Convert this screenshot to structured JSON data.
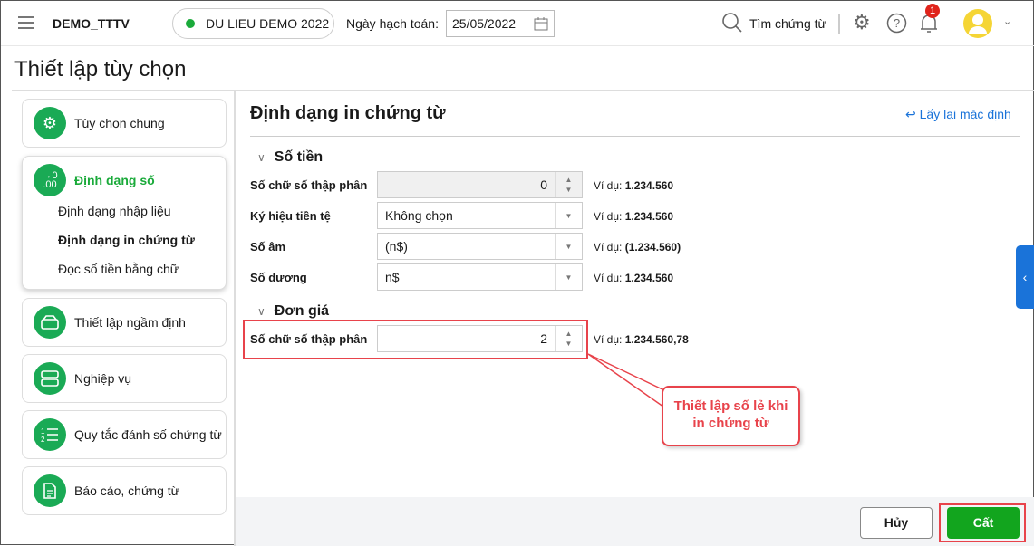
{
  "header": {
    "app_name": "DEMO_TTTV",
    "database": "DU LIEU DEMO 2022",
    "date_label": "Ngày hạch toán:",
    "date_value": "25/05/2022",
    "search_label": "Tìm chứng từ",
    "notification_count": "1"
  },
  "page_title": "Thiết lập tùy chọn",
  "sidebar": {
    "items": [
      {
        "label": "Tùy chọn chung",
        "icon": "gear-icon"
      },
      {
        "label": "Định dạng số",
        "icon": "decimal-icon",
        "active": true,
        "subitems": [
          {
            "label": "Định dạng nhập liệu"
          },
          {
            "label": "Định dạng in chứng từ",
            "active": true
          },
          {
            "label": "Đọc số tiền bằng chữ"
          }
        ]
      },
      {
        "label": "Thiết lập ngầm định",
        "icon": "drive-icon"
      },
      {
        "label": "Nghiệp vụ",
        "icon": "server-icon"
      },
      {
        "label": "Quy tắc đánh số chứng từ",
        "icon": "numbered-list-icon"
      },
      {
        "label": "Báo cáo, chứng từ",
        "icon": "document-icon"
      }
    ]
  },
  "main": {
    "title": "Định dạng in chứng từ",
    "reset_label": "Lấy lại mặc định",
    "sections": [
      {
        "title": "Số tiền",
        "rows": [
          {
            "label": "Số chữ số thập phân",
            "value": "0",
            "example_prefix": "Ví dụ:",
            "example": "1.234.560"
          },
          {
            "label": "Ký hiệu tiền tệ",
            "value": "Không chọn",
            "example_prefix": "Ví dụ:",
            "example": "1.234.560"
          },
          {
            "label": "Số âm",
            "value": "(n$)",
            "example_prefix": "Ví dụ:",
            "example": "(1.234.560)"
          },
          {
            "label": "Số dương",
            "value": "n$",
            "example_prefix": "Ví dụ:",
            "example": "1.234.560"
          }
        ]
      },
      {
        "title": "Đơn giá",
        "rows": [
          {
            "label": "Số chữ số thập phân",
            "value": "2",
            "example_prefix": "Ví dụ:",
            "example": "1.234.560,78"
          }
        ]
      }
    ]
  },
  "callout": "Thiết lập số lẻ khi in chứng từ",
  "footer": {
    "cancel_label": "Hủy",
    "save_label": "Cất"
  },
  "colors": {
    "green": "#1aaa55",
    "save": "#12a51e",
    "link": "#1a73d9",
    "annotation": "#e8434b"
  }
}
